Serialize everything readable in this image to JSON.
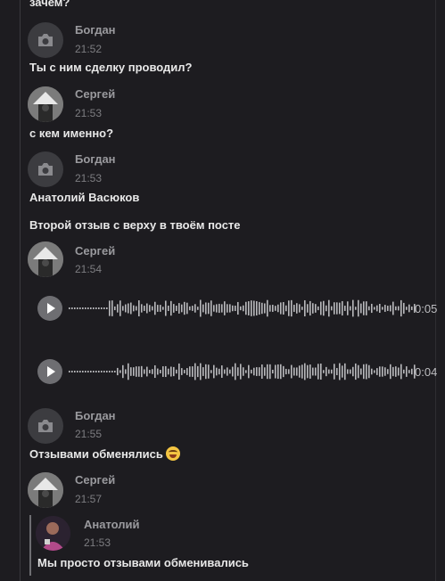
{
  "colors": {
    "background": "#1d1c20",
    "avatar_placeholder": "#3c3c40",
    "accent_text": "#e8e8e8"
  },
  "top_fragment": "зачем?",
  "messages": [
    {
      "author": "Богдан",
      "time": "21:52",
      "avatar": "camera-icon",
      "lines": [
        "Ты с ним сделку проводил?"
      ]
    },
    {
      "author": "Сергей",
      "time": "21:53",
      "avatar": "photo",
      "lines": [
        "с кем именно?"
      ]
    },
    {
      "author": "Богдан",
      "time": "21:53",
      "avatar": "camera-icon",
      "lines": [
        "Анатолий Васюков",
        "Второй отзыв с верху в твоём посте"
      ]
    },
    {
      "author": "Сергей",
      "time": "21:54",
      "avatar": "photo",
      "voice": [
        "0:05",
        "0:04"
      ]
    },
    {
      "author": "Богдан",
      "time": "21:55",
      "avatar": "camera-icon",
      "lines": [
        "Отзывами обменялись"
      ],
      "emoji": "rofl-emoji"
    },
    {
      "author": "Сергей",
      "time": "21:57",
      "avatar": "photo"
    }
  ],
  "reply": {
    "author": "Анатолий",
    "time": "21:53",
    "text": "Мы просто отзывами обменивались"
  }
}
